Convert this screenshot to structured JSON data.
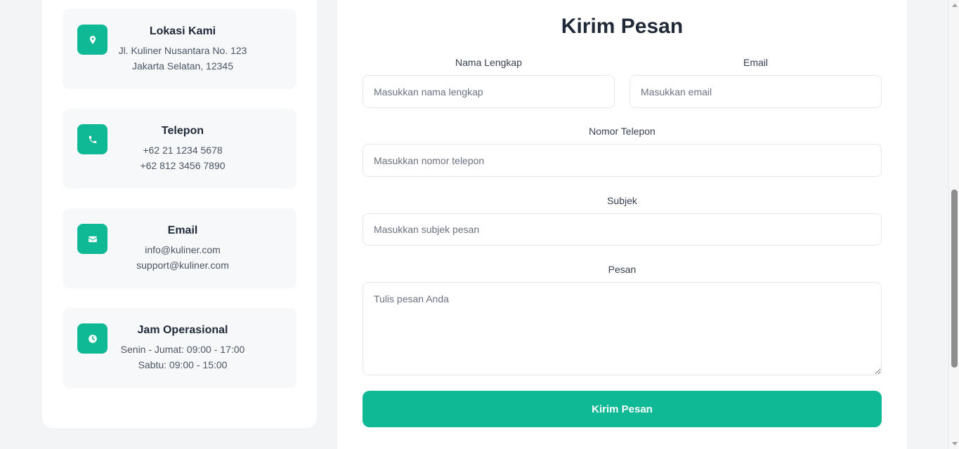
{
  "contact_info": [
    {
      "title": "Lokasi Kami",
      "lines": [
        "Jl. Kuliner Nusantara No. 123",
        "Jakarta Selatan, 12345"
      ],
      "icon": "map-pin-icon"
    },
    {
      "title": "Telepon",
      "lines": [
        "+62 21 1234 5678",
        "+62 812 3456 7890"
      ],
      "icon": "phone-icon"
    },
    {
      "title": "Email",
      "lines": [
        "info@kuliner.com",
        "support@kuliner.com"
      ],
      "icon": "envelope-icon"
    },
    {
      "title": "Jam Operasional",
      "lines": [
        "Senin - Jumat: 09:00 - 17:00",
        "Sabtu: 09:00 - 15:00"
      ],
      "icon": "clock-icon"
    }
  ],
  "form": {
    "title": "Kirim Pesan",
    "name": {
      "label": "Nama Lengkap",
      "placeholder": "Masukkan nama lengkap",
      "value": ""
    },
    "email": {
      "label": "Email",
      "placeholder": "Masukkan email",
      "value": ""
    },
    "phone": {
      "label": "Nomor Telepon",
      "placeholder": "Masukkan nomor telepon",
      "value": ""
    },
    "subject": {
      "label": "Subjek",
      "placeholder": "Masukkan subjek pesan",
      "value": ""
    },
    "message": {
      "label": "Pesan",
      "placeholder": "Tulis pesan Anda",
      "value": ""
    },
    "submit_label": "Kirim Pesan"
  },
  "colors": {
    "accent": "#10b995",
    "card_bg": "#f7f8fa",
    "page_bg": "#f3f4f6"
  }
}
